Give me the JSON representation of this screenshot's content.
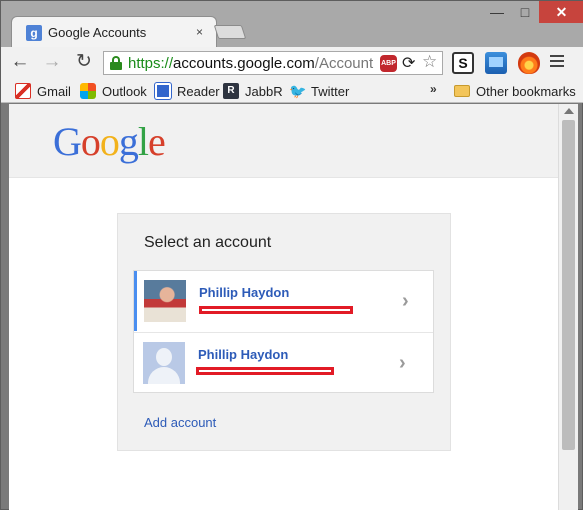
{
  "browser": {
    "tab": {
      "title": "Google Accounts",
      "favicon": "google-favicon",
      "close": "×"
    },
    "window_controls": {
      "minimize": "—",
      "maximize": "□",
      "close": "✕"
    },
    "nav": {
      "back": "←",
      "forward": "→",
      "reload": "↻"
    },
    "omnibox": {
      "scheme": "https://",
      "host": "accounts.google.com",
      "path": "/Account"
    },
    "extensions": {
      "abp": "ABP",
      "s_label": "S"
    },
    "bookmarks": [
      {
        "label": "Gmail",
        "icon": "gmail-icon"
      },
      {
        "label": "Outlook",
        "icon": "outlook-icon"
      },
      {
        "label": "Reader",
        "icon": "reader-icon"
      },
      {
        "label": "JabbR",
        "icon": "jabbr-icon"
      },
      {
        "label": "Twitter",
        "icon": "twitter-icon"
      }
    ],
    "bookmarks_overflow": "»",
    "other_bookmarks": "Other bookmarks"
  },
  "page": {
    "logo": {
      "letters": [
        "G",
        "o",
        "o",
        "g",
        "l",
        "e"
      ]
    },
    "chooser": {
      "title": "Select an account",
      "accounts": [
        {
          "name": "Phillip Haydon",
          "email_redacted": true
        },
        {
          "name": "Phillip Haydon",
          "email_redacted": true
        }
      ],
      "add_account": "Add account"
    }
  },
  "colors": {
    "accent_blue": "#2d5bb8",
    "selected_bar": "#4a8ef0",
    "redaction": "#e21b26",
    "close_button": "#c7443d"
  }
}
